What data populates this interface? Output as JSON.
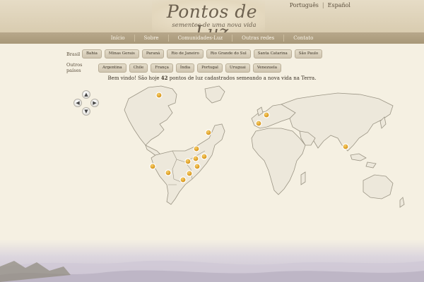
{
  "header": {
    "logo_title": "Pontos de Luz",
    "logo_subtitle": "sementes de uma nova vida",
    "languages": [
      "Português",
      "Español"
    ]
  },
  "nav": {
    "items": [
      "Início",
      "Sobre",
      "Comunidades-Luz",
      "Outras redes",
      "Contato"
    ]
  },
  "filters": {
    "brasil_label": "Brasil",
    "brasil": [
      "Bahia",
      "Minas Gerais",
      "Paraná",
      "Rio de Janeiro",
      "Rio Grande do Sul",
      "Santa Catarina",
      "São Paulo"
    ],
    "outros_label": "Outros países",
    "outros": [
      "Argentina",
      "Chile",
      "França",
      "Índia",
      "Portugal",
      "Uruguai",
      "Venezuela"
    ]
  },
  "welcome": {
    "prefix": "Bem vindo! São hoje",
    "count": "42",
    "suffix": "pontos de luz cadastrados semeando a nova vida na Terra."
  },
  "pan_controls": {
    "up_icon": "chevron-up-icon",
    "down_icon": "chevron-down-icon",
    "left_icon": "chevron-left-icon",
    "right_icon": "chevron-right-icon"
  },
  "colors": {
    "marker": "#e3a21f",
    "land": "#ede8db",
    "border": "#9a9484",
    "nav_bg": "#ad9d7e"
  }
}
